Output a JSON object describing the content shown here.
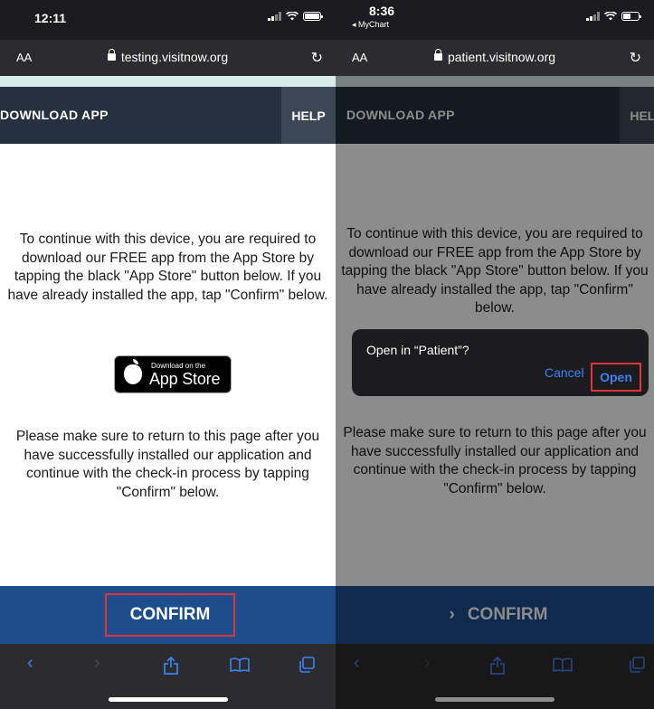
{
  "left": {
    "status": {
      "time": "12:11"
    },
    "browser": {
      "text_size": "AA",
      "url": "testing.visitnow.org"
    },
    "nav": {
      "download": "DOWNLOAD APP",
      "help": "HELP"
    },
    "message": "To continue with this device, you are required to download our FREE app from the App Store by tapping the black \"App Store\" button below. If you have already installed the app, tap \"Confirm\" below.",
    "appstore": {
      "small": "Download on the",
      "big": "App Store"
    },
    "return_message": "Please make sure to return to this page after you have successfully installed our application and continue with the check-in process by tapping \"Confirm\" below.",
    "confirm": "CONFIRM"
  },
  "right": {
    "status": {
      "time": "8:36",
      "back_app": "◂ MyChart"
    },
    "browser": {
      "text_size": "AA",
      "url": "patient.visitnow.org"
    },
    "nav": {
      "download": "DOWNLOAD APP",
      "help": "HELP"
    },
    "message": "To continue with this device, you are required to download our FREE app from the App Store by tapping the black \"App Store\" button below. If you have already installed the app, tap \"Confirm\" below.",
    "dialog": {
      "title": "Open in “Patient”?",
      "cancel": "Cancel",
      "open": "Open"
    },
    "return_message": "Please make sure to return to this page after you have successfully installed our application and continue with the check-in process by tapping \"Confirm\" below.",
    "confirm": "CONFIRM"
  },
  "icons": {
    "back": "chevron-left-icon",
    "forward": "chevron-right-icon",
    "share": "share-icon",
    "bookmarks": "book-icon",
    "tabs": "tabs-icon",
    "reload": "reload-icon",
    "lock": "lock-icon"
  },
  "colors": {
    "nav_bg": "#26313f",
    "confirm_bg": "#1e4d8c",
    "highlight": "#e0353b",
    "ios_blue": "#3b82f6",
    "accent_strip": "#d9ebe7"
  }
}
